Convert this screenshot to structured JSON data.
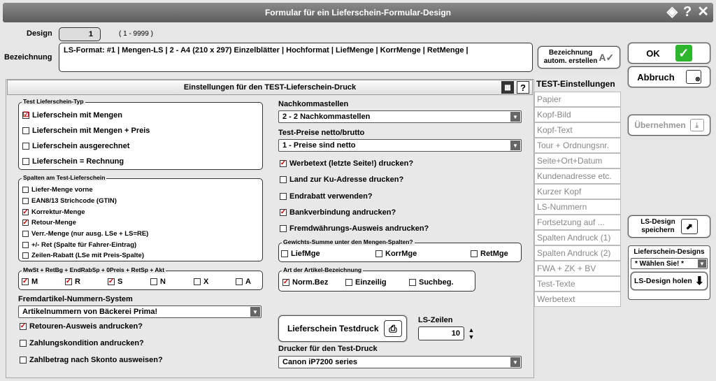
{
  "window": {
    "title": "Formular für ein Lieferschein-Formular-Design"
  },
  "design": {
    "label": "Design",
    "value": "1",
    "range": "( 1 - 9999 )"
  },
  "bezeichnung": {
    "label": "Bezeichnung",
    "value": "LS-Format: #1 | Mengen-LS | 2 - A4 (210 x 297) Einzelblätter | Hochformat | LiefMenge | KorrMenge | RetMenge |",
    "auto_btn_line1": "Bezeichnung",
    "auto_btn_line2": "autom. erstellen"
  },
  "buttons": {
    "ok": "OK",
    "abbruch": "Abbruch",
    "uebernehmen": "Übernehmen",
    "ls_design_save_1": "LS-Design",
    "ls_design_save_2": "speichern",
    "ls_design_get": "LS-Design holen",
    "testdruck": "Lieferschein Testdruck"
  },
  "panel": {
    "title": "Einstellungen für den TEST-Lieferschein-Druck",
    "help": "?"
  },
  "typ": {
    "title": "Test Lieferschein-Typ",
    "items": [
      {
        "label": "Lieferschein mit Mengen",
        "checked": "☑"
      },
      {
        "label": "Lieferschein mit Mengen + Preis",
        "checked": ""
      },
      {
        "label": "Lieferschein ausgerechnet",
        "checked": ""
      },
      {
        "label": "Lieferschein = Rechnung",
        "checked": ""
      }
    ]
  },
  "spalten": {
    "title": "Spalten am Test-Lieferschein",
    "items": [
      {
        "label": "Liefer-Menge vorne",
        "checked": ""
      },
      {
        "label": "EAN8/13 Strichcode (GTIN)",
        "checked": ""
      },
      {
        "label": "Korrektur-Menge",
        "checked": "✓"
      },
      {
        "label": "Retour-Menge",
        "checked": "✓"
      },
      {
        "label": "Verr.-Menge (nur ausg. LSe + LS=RE)",
        "checked": ""
      },
      {
        "label": "+/- Ret  (Spalte für Fahrer-Eintrag)",
        "checked": ""
      },
      {
        "label": "Zeilen-Rabatt (LSe mit Preis-Spalte)",
        "checked": ""
      }
    ]
  },
  "mwst": {
    "title": "MwSt + RetBg + EndRabSp + 0Preis + RetSp + Akt",
    "items": [
      {
        "label": "M",
        "checked": "✓"
      },
      {
        "label": "R",
        "checked": "✓"
      },
      {
        "label": "S",
        "checked": "✓"
      },
      {
        "label": "N",
        "checked": ""
      },
      {
        "label": "X",
        "checked": ""
      },
      {
        "label": "A",
        "checked": ""
      }
    ]
  },
  "fremd": {
    "label": "Fremdartikel-Nummern-System",
    "value": "Artikelnummern von Bäckerei Prima!"
  },
  "bottom_checks": [
    {
      "label": "Retouren-Ausweis andrucken?",
      "checked": "✓"
    },
    {
      "label": "Zahlungskondition andrucken?",
      "checked": ""
    },
    {
      "label": "Zahlbetrag nach Skonto ausweisen?",
      "checked": ""
    }
  ],
  "nachkomma": {
    "label": "Nachkommastellen",
    "value": "2 - 2 Nachkommastellen"
  },
  "preise": {
    "label": "Test-Preise netto/brutto",
    "value": "1 - Preise sind netto"
  },
  "mid_checks": [
    {
      "label": "Werbetext (letzte Seite!) drucken?",
      "checked": "✓"
    },
    {
      "label": "Land zur Ku-Adresse drucken?",
      "checked": ""
    },
    {
      "label": "Endrabatt verwenden?",
      "checked": ""
    },
    {
      "label": "Bankverbindung andrucken?",
      "checked": "✓"
    },
    {
      "label": "Fremdwährungs-Ausweis andrucken?",
      "checked": ""
    }
  ],
  "gewicht": {
    "title": "Gewichts-Summe unter den Mengen-Spalten?",
    "items": [
      {
        "label": "LiefMge",
        "checked": ""
      },
      {
        "label": "KorrMge",
        "checked": ""
      },
      {
        "label": "RetMge",
        "checked": ""
      }
    ]
  },
  "artbez": {
    "title": "Art der Artikel-Bezeichnung",
    "items": [
      {
        "label": "Norm.Bez",
        "checked": "✓"
      },
      {
        "label": "Einzeilig",
        "checked": ""
      },
      {
        "label": "Suchbeg.",
        "checked": ""
      }
    ]
  },
  "lszeilen": {
    "label": "LS-Zeilen",
    "value": "10"
  },
  "drucker": {
    "label": "Drucker für den Test-Druck",
    "value": "Canon iP7200 series"
  },
  "tabs": {
    "header": "TEST-Einstellungen",
    "items": [
      "Papier",
      "Kopf-Bild",
      "Kopf-Text",
      "Tour + Ordnungsnr.",
      "Seite+Ort+Datum",
      "Kundenadresse etc.",
      "Kurzer Kopf",
      "LS-Nummern",
      "Fortsetzung auf ...",
      "Spalten Andruck (1)",
      "Spalten Andruck (2)",
      "FWA + ZK + BV",
      "Test-Texte",
      "Werbetext"
    ]
  },
  "designs": {
    "label": "Lieferschein-Designs",
    "value": "* Wählen Sie! *"
  }
}
